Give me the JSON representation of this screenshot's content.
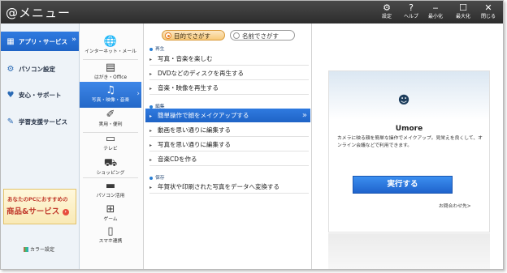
{
  "app": {
    "title": "@メニュー"
  },
  "titlebar": {
    "buttons": [
      {
        "label": "設定",
        "icon": "gear-icon"
      },
      {
        "label": "ヘルプ",
        "icon": "help-icon"
      },
      {
        "label": "最小化",
        "icon": "minimize-icon"
      },
      {
        "label": "最大化",
        "icon": "maximize-icon"
      },
      {
        "label": "閉じる",
        "icon": "close-icon"
      }
    ]
  },
  "sidebar": {
    "items": [
      {
        "label": "アプリ・サービス",
        "icon": "apps-icon",
        "active": true
      },
      {
        "label": "パソコン設定",
        "icon": "gear-icon"
      },
      {
        "label": "安心・サポート",
        "icon": "heart-icon"
      },
      {
        "label": "学習支援サービス",
        "icon": "learning-icon"
      }
    ],
    "promo": {
      "line1": "あなたのPCにおすすめの",
      "line2": "商品&サービス",
      "badge": "›"
    },
    "color_setting": "カラー設定"
  },
  "categories": [
    {
      "label": "インターネット・メール",
      "icon": "globe-mail-icon"
    },
    {
      "label": "はがき・Office",
      "icon": "document-icon"
    },
    {
      "label": "写真・映像・音楽",
      "icon": "photo-music-icon",
      "active": true
    },
    {
      "label": "実用・便利",
      "icon": "pen-tools-icon"
    },
    {
      "label": "テレビ",
      "icon": "tv-icon"
    },
    {
      "label": "ショッピング",
      "icon": "basket-icon"
    },
    {
      "label": "パソコン活用",
      "icon": "laptop-icon"
    },
    {
      "label": "ゲーム",
      "icon": "gamepad-icon"
    },
    {
      "label": "スマホ連携",
      "icon": "phone-link-icon"
    }
  ],
  "search_mode": {
    "purpose": "目的でさがす",
    "name": "名前でさがす",
    "selected": "purpose"
  },
  "menu": {
    "sections": [
      {
        "title": "再生",
        "items": [
          "写真・音楽を楽しむ",
          "DVDなどのディスクを再生する",
          "音楽・映像を再生する"
        ]
      },
      {
        "title": "編集",
        "items": [
          "簡単操作で顔をメイクアップする",
          "動画を思い通りに編集する",
          "写真を思い通りに編集する",
          "音楽CDを作る"
        ]
      },
      {
        "title": "保存",
        "items": [
          "年賀状や印刷された写真をデータへ変換する"
        ]
      }
    ],
    "active_item": "簡単操作で顔をメイクアップする"
  },
  "detail": {
    "app_name": "Umore",
    "icon": "makeup-app-icon",
    "description": "カメラに映る顔を簡単な操作でメイクアップ。見栄えを良くして、オンライン会議などで利用できます。",
    "run_button": "実行する",
    "contact": "お問合わせ先>"
  },
  "colors": {
    "titlebar": "#333333",
    "accent_blue": "#2468c8",
    "toggle_orange": "#f7c97a",
    "promo_red": "#c0392b"
  }
}
